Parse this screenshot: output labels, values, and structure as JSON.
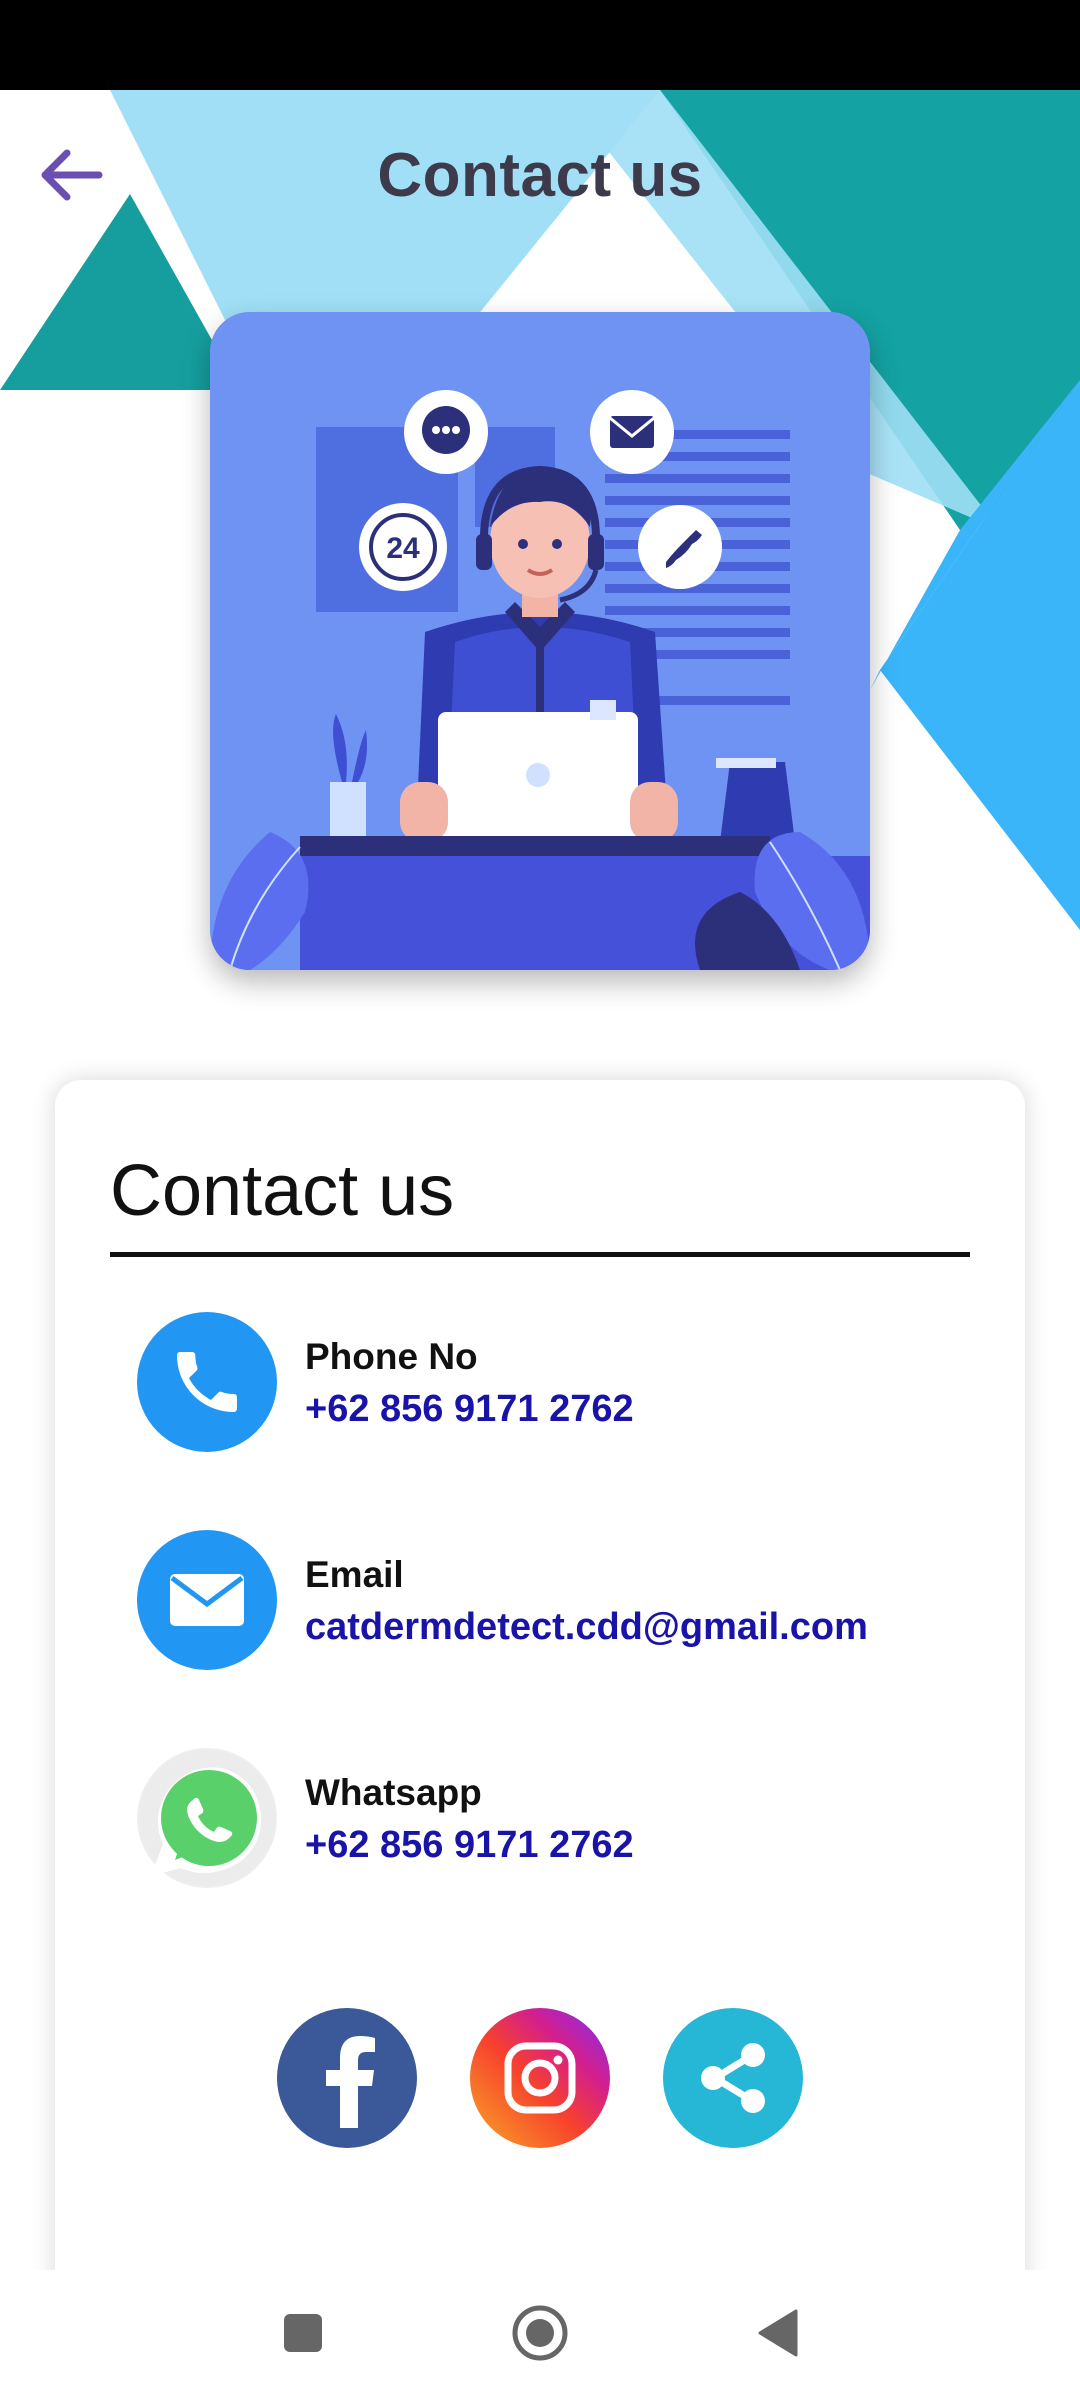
{
  "header": {
    "title": "Contact us"
  },
  "card": {
    "title": "Contact us",
    "contacts": [
      {
        "label": "Phone No",
        "value": "+62 856 9171 2762"
      },
      {
        "label": "Email",
        "value": "catdermdetect.cdd@gmail.com"
      },
      {
        "label": "Whatsapp",
        "value": "+62 856 9171 2762"
      }
    ]
  },
  "social": [
    "facebook-icon",
    "instagram-icon",
    "share-icon"
  ],
  "hero": {
    "badge_text": "24"
  },
  "colors": {
    "title": "#3d3a4b",
    "back_arrow": "#6a4fb0",
    "link_value": "#1a13a8",
    "phone_blue": "#2196f3",
    "whatsapp_green": "#5ad06a",
    "facebook_blue": "#3b5998",
    "share_cyan": "#26b6d6"
  }
}
